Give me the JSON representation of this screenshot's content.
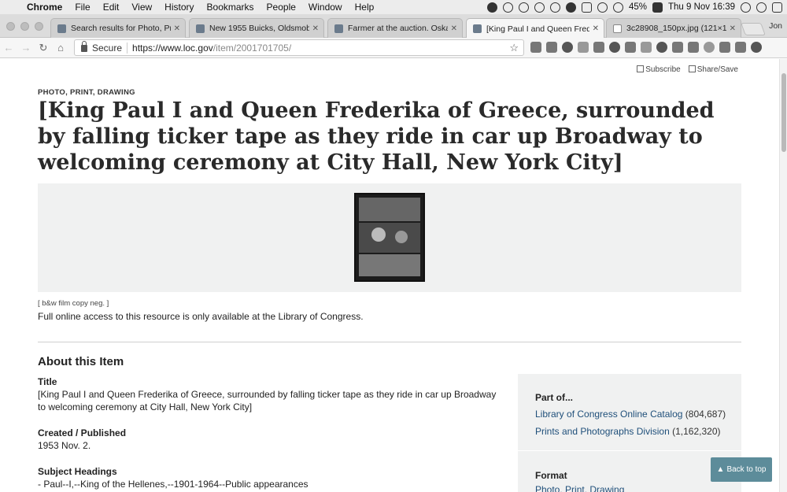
{
  "menubar": {
    "app_name": "Chrome",
    "items": [
      "File",
      "Edit",
      "View",
      "History",
      "Bookmarks",
      "People",
      "Window",
      "Help"
    ],
    "battery": "45%",
    "clock": "Thu 9 Nov  16:39"
  },
  "tabs": [
    {
      "label": "Search results for Photo, Print",
      "active": false
    },
    {
      "label": "New 1955 Buicks, Oldsmobile",
      "active": false
    },
    {
      "label": "Farmer at the auction. Oskalo",
      "active": false
    },
    {
      "label": "[King Paul I and Queen Freder",
      "active": true
    },
    {
      "label": "3c28908_150px.jpg (121×15",
      "active": false
    }
  ],
  "user_label": "Jon",
  "toolbar": {
    "secure_label": "Secure",
    "url_scheme": "https://www.loc.gov",
    "url_path": "/item/2001701705/"
  },
  "page": {
    "subscribe": "Subscribe",
    "share_save": "Share/Save",
    "eyebrow": "PHOTO, PRINT, DRAWING",
    "title": "[King Paul I and Queen Frederika of Greece, surrounded by falling ticker tape as they ride in car up Broadway to welcoming ceremony at City Hall, New York City]",
    "caption": "[ b&w film copy neg. ]",
    "access_note": "Full online access to this resource is only available at the Library of Congress.",
    "about_heading": "About this Item",
    "fields": {
      "title_label": "Title",
      "title_value": "[King Paul I and Queen Frederika of Greece, surrounded by falling ticker tape as they ride in car up Broadway to welcoming ceremony at City Hall, New York City]",
      "created_label": "Created / Published",
      "created_value": "1953 Nov. 2.",
      "subject_label": "Subject Headings",
      "subject_value": "-  Paul--I,--King of the Hellenes,--1901-1964--Public appearances"
    },
    "sidebar": {
      "part_of": "Part of...",
      "links": [
        {
          "label": "Library of Congress Online Catalog",
          "count": "(804,687)"
        },
        {
          "label": "Prints and Photographs Division",
          "count": "(1,162,320)"
        }
      ],
      "format_heading": "Format",
      "format_value": "Photo, Print, Drawing"
    },
    "back_to_top": "Back to top"
  }
}
